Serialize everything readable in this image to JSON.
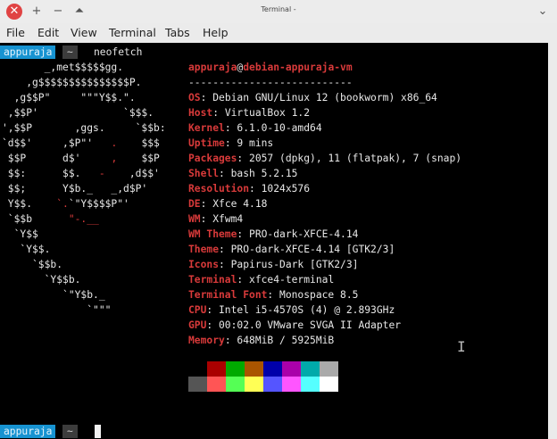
{
  "window": {
    "title": "Terminal -"
  },
  "titlebar": {
    "close": "✕",
    "add": "+",
    "minimize": "−",
    "maximize": "⏶",
    "chevron": "⌄"
  },
  "menu": [
    "File",
    "Edit",
    "View",
    "Terminal",
    "Tabs",
    "Help"
  ],
  "prompt": {
    "user": "appuraja",
    "sep": "~",
    "command": "neofetch"
  },
  "logo": [
    {
      "w": "       _,met$$$$$gg.",
      "r": ""
    },
    {
      "w": "    ,g$$$$$$$$$$$$$$$P.",
      "r": ""
    },
    {
      "w": "  ,g$$P\"     \"\"\"Y$$.\".",
      "r": ""
    },
    {
      "w": " ,$$P'              `$$$.",
      "r": ""
    },
    {
      "w": "',$$P       ,ggs.     `$$b:",
      "r": ""
    },
    {
      "w": "`d$$'     ,$P\"'   ",
      "r": ".",
      "t": "    $$$"
    },
    {
      "w": " $$P      d$'     ",
      "r": ",",
      "t": "    $$P"
    },
    {
      "w": " $$:      $$.   ",
      "r": "-",
      "t": "    ,d$$'"
    },
    {
      "w": " $$;      Y$b._   _,d$P'",
      "r": ""
    },
    {
      "w": " Y$$.    ",
      "r": "`.",
      "t": "`\"Y$$$$P\"'"
    },
    {
      "w": " `$$b      ",
      "r": "\"-.__",
      "t": ""
    },
    {
      "w": "  `Y$$",
      "r": ""
    },
    {
      "w": "   `Y$$.",
      "r": ""
    },
    {
      "w": "     `$$b.",
      "r": ""
    },
    {
      "w": "       `Y$$b.",
      "r": ""
    },
    {
      "w": "          `\"Y$b._",
      "r": ""
    },
    {
      "w": "              `\"\"\"",
      "r": ""
    }
  ],
  "info": {
    "user": "appuraja",
    "at": "@",
    "host": "debian-appuraja-vm",
    "separator": "---------------------------",
    "rows": [
      {
        "key": "OS",
        "value": ": Debian GNU/Linux 12 (bookworm) x86_64"
      },
      {
        "key": "Host",
        "value": ": VirtualBox 1.2"
      },
      {
        "key": "Kernel",
        "value": ": 6.1.0-10-amd64"
      },
      {
        "key": "Uptime",
        "value": ": 9 mins"
      },
      {
        "key": "Packages",
        "value": ": 2057 (dpkg), 11 (flatpak), 7 (snap)"
      },
      {
        "key": "Shell",
        "value": ": bash 5.2.15"
      },
      {
        "key": "Resolution",
        "value": ": 1024x576"
      },
      {
        "key": "DE",
        "value": ": Xfce 4.18"
      },
      {
        "key": "WM",
        "value": ": Xfwm4"
      },
      {
        "key": "WM Theme",
        "value": ": PRO-dark-XFCE-4.14"
      },
      {
        "key": "Theme",
        "value": ": PRO-dark-XFCE-4.14 [GTK2/3]"
      },
      {
        "key": "Icons",
        "value": ": Papirus-Dark [GTK2/3]"
      },
      {
        "key": "Terminal",
        "value": ": xfce4-terminal"
      },
      {
        "key": "Terminal Font",
        "value": ": Monospace 8.5"
      },
      {
        "key": "CPU",
        "value": ": Intel i5-4570S (4) @ 2.893GHz"
      },
      {
        "key": "GPU",
        "value": ": 00:02.0 VMware SVGA II Adapter"
      },
      {
        "key": "Memory",
        "value": ": 648MiB / 5925MiB"
      }
    ]
  },
  "palette": {
    "normal": [
      "#000000",
      "#aa0000",
      "#00aa00",
      "#aa5500",
      "#0000aa",
      "#aa00aa",
      "#00aaaa",
      "#aaaaaa"
    ],
    "bright": [
      "#555555",
      "#ff5555",
      "#55ff55",
      "#ffff55",
      "#5555ff",
      "#ff55ff",
      "#55ffff",
      "#ffffff"
    ]
  },
  "prompt2": {
    "user": "appuraja",
    "sep": "~"
  }
}
